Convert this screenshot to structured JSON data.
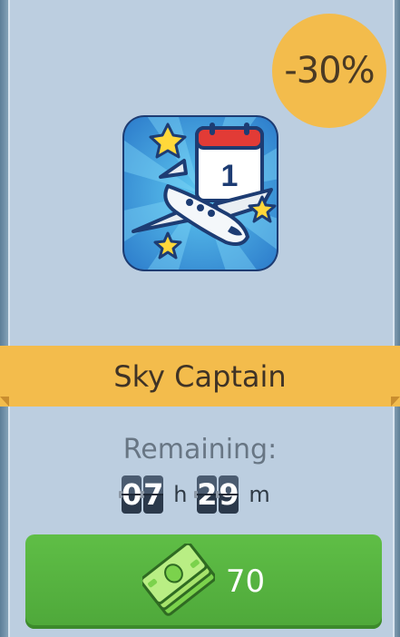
{
  "discount": {
    "label": "-30%"
  },
  "item": {
    "name": "Sky Captain",
    "icon": "airplane-calendar-icon",
    "calendar_day": "1"
  },
  "timer": {
    "label": "Remaining:",
    "hours": [
      "0",
      "7"
    ],
    "hours_unit": "h",
    "minutes": [
      "2",
      "9"
    ],
    "minutes_unit": "m"
  },
  "purchase": {
    "price": "70",
    "currency_icon": "cash-stack-icon"
  },
  "colors": {
    "badge": "#f3bc4c",
    "card": "#bccee0",
    "button": "#5fbe46"
  }
}
